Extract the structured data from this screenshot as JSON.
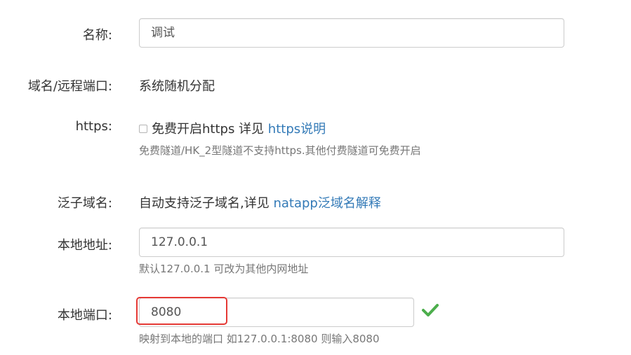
{
  "form": {
    "name": {
      "label": "名称:",
      "value": "调试"
    },
    "domain": {
      "label": "域名/远程端口:",
      "value": "系统随机分配"
    },
    "https": {
      "label": "https:",
      "checkbox_label": "免费开启https 详见",
      "link": "https说明",
      "checked": false,
      "help": "免费隧道/HK_2型隧道不支持https.其他付费隧道可免费开启"
    },
    "wildcard": {
      "label": "泛子域名:",
      "text": "自动支持泛子域名,详见",
      "link": "natapp泛域名解释"
    },
    "local_address": {
      "label": "本地地址:",
      "value": "127.0.0.1",
      "help": "默认127.0.0.1 可改为其他内网地址"
    },
    "local_port": {
      "label": "本地端口:",
      "value": "8080",
      "help": "映射到本地的端口 如127.0.0.1:8080 则输入8080",
      "valid_icon": "check-icon",
      "valid_color": "#4cae4c"
    }
  },
  "highlight_color": "#e53935"
}
